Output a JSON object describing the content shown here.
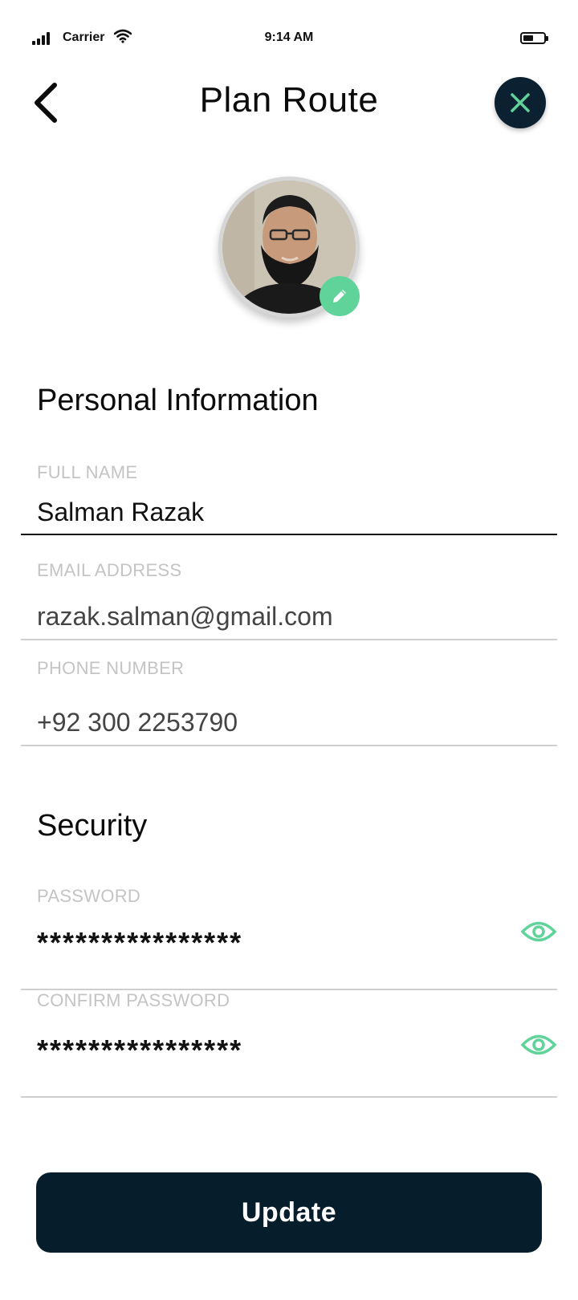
{
  "status_bar": {
    "carrier": "Carrier",
    "time": "9:14 AM",
    "icons": [
      "signal-icon",
      "wifi-icon",
      "battery-icon"
    ]
  },
  "header": {
    "title": "Plan Route",
    "back_icon": "chevron-left-icon",
    "close_icon": "close-icon"
  },
  "profile": {
    "avatar": "profile-photo",
    "edit_icon": "pencil-icon"
  },
  "personal": {
    "heading": "Personal Information",
    "full_name_label": "FULL NAME",
    "full_name_value": "Salman Razak",
    "email_label": "EMAIL ADDRESS",
    "email_value": "razak.salman@gmail.com",
    "phone_label": "PHONE NUMBER",
    "phone_value": "+92 300 2253790"
  },
  "security": {
    "heading": "Security",
    "password_label": "PASSWORD",
    "password_value": "****************",
    "confirm_label": "CONFIRM PASSWORD",
    "confirm_value": "****************",
    "eye_icon": "eye-icon"
  },
  "actions": {
    "update_label": "Update"
  },
  "colors": {
    "accent": "#5fd39a",
    "dark": "#061e2c",
    "label": "#c4c4c4"
  }
}
